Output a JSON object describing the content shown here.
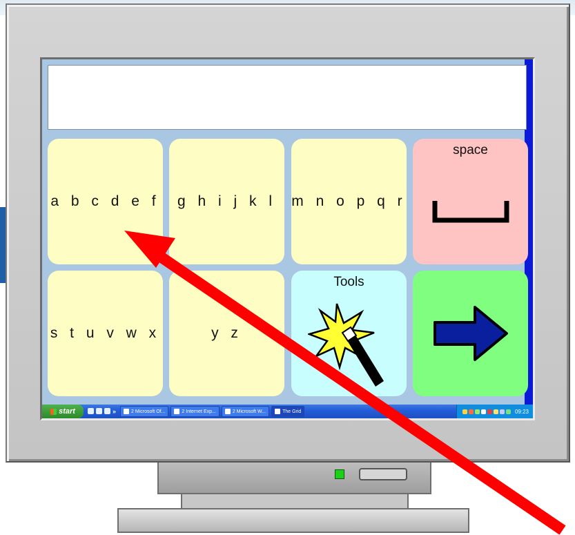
{
  "grid": {
    "row1": [
      {
        "label": "a b c d e f"
      },
      {
        "label": "g h i j k l"
      },
      {
        "label": "m n o p q r"
      },
      {
        "label": "space"
      }
    ],
    "row2": [
      {
        "label": "s t u v w x"
      },
      {
        "label": "y z"
      },
      {
        "label": "Tools"
      },
      {
        "label": ""
      }
    ]
  },
  "taskbar": {
    "start_label": "start",
    "chevron": "»",
    "tasks": [
      {
        "label": "2 Microsoft Of..."
      },
      {
        "label": "2 Internet Exp..."
      },
      {
        "label": "2 Microsoft W..."
      },
      {
        "label": "The Grid"
      }
    ],
    "clock": "09:23"
  },
  "colors": {
    "yellow_cell": "#fefec4",
    "space_cell": "#fec3c3",
    "tools_cell": "#c8fefe",
    "next_cell": "#80fe80",
    "pointer_arrow": "#ff0000",
    "grid_background": "#a9c6e3"
  },
  "icons": {
    "space_cell": "space-bar-icon",
    "tools_cell": "magic-wand-icon",
    "next_cell": "right-arrow-icon",
    "overlay": "pointer-arrow"
  }
}
